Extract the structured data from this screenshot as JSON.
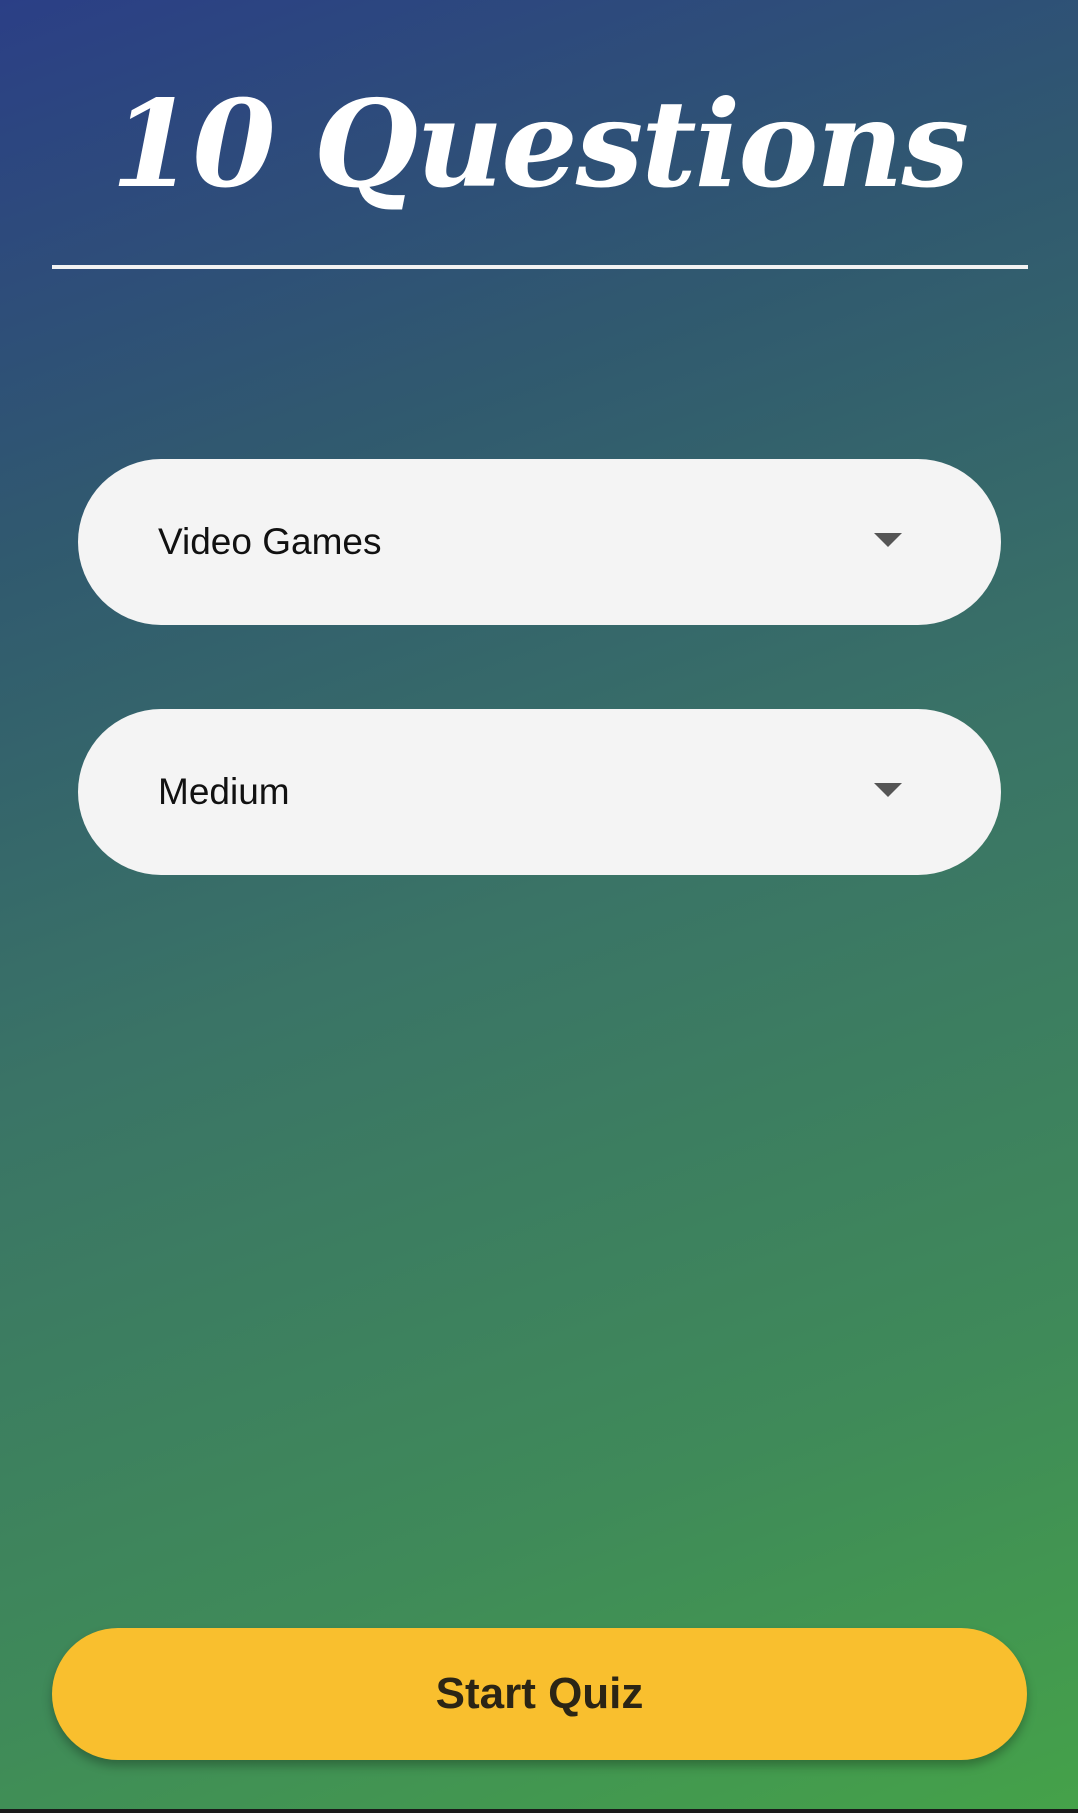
{
  "header": {
    "title": "10 Questions"
  },
  "form": {
    "category_select": {
      "selected": "Video Games",
      "icon": "chevron-down-icon"
    },
    "difficulty_select": {
      "selected": "Medium",
      "icon": "chevron-down-icon"
    }
  },
  "actions": {
    "start_label": "Start Quiz"
  },
  "colors": {
    "gradient_start": "#2b3f86",
    "gradient_end": "#45a249",
    "select_bg": "#f4f4f4",
    "button_bg": "#f9bf2e"
  }
}
